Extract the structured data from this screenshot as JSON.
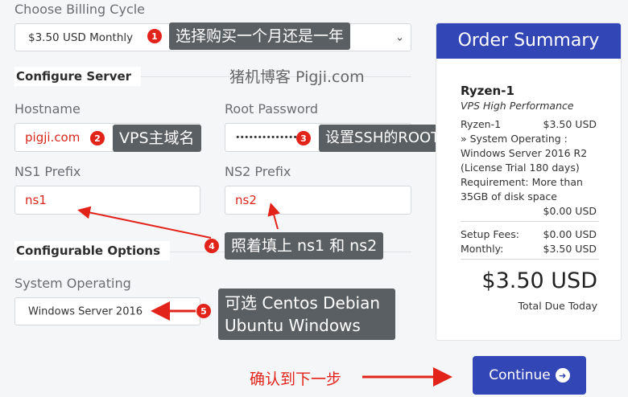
{
  "billing": {
    "label": "Choose Billing Cycle",
    "selected": "$3.50 USD Monthly"
  },
  "configure_server": {
    "heading": "Configure Server",
    "hostname_label": "Hostname",
    "hostname_value": "pigji.com",
    "root_password_label": "Root Password",
    "root_password_value": "••••••••••••••",
    "ns1_label": "NS1 Prefix",
    "ns1_value": "ns1",
    "ns2_label": "NS2 Prefix",
    "ns2_value": "ns2"
  },
  "configurable_options": {
    "heading": "Configurable Options",
    "os_label": "System Operating",
    "os_selected": "Windows Server 2016"
  },
  "watermark": "猪机博客 Pigji.com",
  "annotations": [
    {
      "num": "1",
      "text": "选择购买一个月还是一年"
    },
    {
      "num": "2",
      "text": "VPS主域名"
    },
    {
      "num": "3",
      "text": "设置SSH的ROOT密码"
    },
    {
      "num": "4",
      "text": "照着填上 ns1 和 ns2"
    },
    {
      "num": "5",
      "line1": "可选 Centos Debian",
      "line2": "Ubuntu Windows"
    }
  ],
  "confirm_text": "确认到下一步",
  "order_summary": {
    "title": "Order Summary",
    "product_name": "Ryzen-1",
    "product_group": "VPS High Performance",
    "line_item": "Ryzen-1",
    "line_price": "$3.50 USD",
    "os_line1": "» System Operating :",
    "os_line2": "Windows Server 2016 R2",
    "os_line3": "(License Trial 180 days)",
    "req_line1": "Requirement: More than",
    "req_line2": "35GB of disk space",
    "os_price": "$0.00 USD",
    "setup_label": "Setup Fees:",
    "setup_value": "$0.00 USD",
    "monthly_label": "Monthly:",
    "monthly_value": "$3.50 USD",
    "total": "$3.50 USD",
    "total_label": "Total Due Today"
  },
  "continue_label": "Continue",
  "colors": {
    "accent": "#3346b6",
    "annotation_red": "#e2231a",
    "tooltip_bg": "#5a5f63"
  }
}
